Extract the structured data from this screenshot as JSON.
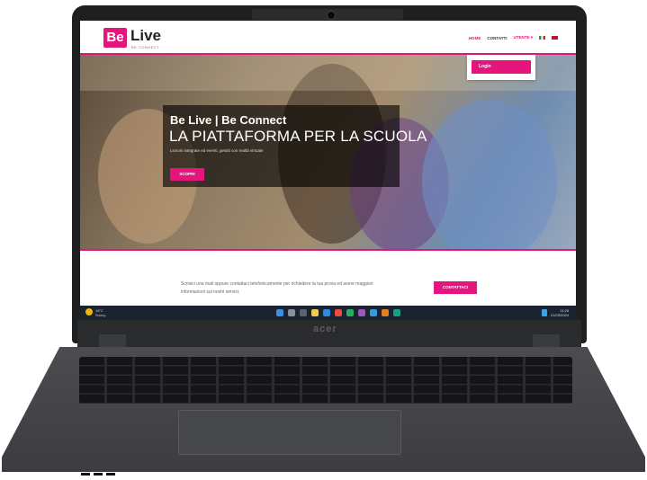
{
  "site": {
    "logo_mark": "Be",
    "logo_word": "Live",
    "logo_tagline": "BE CONNECT",
    "nav": {
      "home": "HOME",
      "contacts": "CONTATTI",
      "user": "UTENTE ▾"
    },
    "dropdown": {
      "login_label": "Login"
    },
    "hero": {
      "subtitle": "Be Live | Be Connect",
      "title": "LA PIATTAFORMA PER LA SCUOLA",
      "description": "Lezioni integrate ed eventi, gestiti con realtà virtuale",
      "cta_label": "SCOPRI"
    },
    "contact": {
      "text": "Scrivici una mail oppure contattaci telefonicamente per richiedere la tua prova ed avere maggiori informazioni sui nostri servizi.",
      "button_label": "CONTATTACI"
    }
  },
  "taskbar": {
    "weather_temp": "18°C",
    "weather_desc": "Sunny",
    "time": "11:28",
    "date": "21/03/2024"
  },
  "laptop": {
    "brand": "acer"
  },
  "colors": {
    "brand_pink": "#e6157d",
    "taskbar": "#1b2230",
    "laptop_body": "#3c3d40"
  }
}
